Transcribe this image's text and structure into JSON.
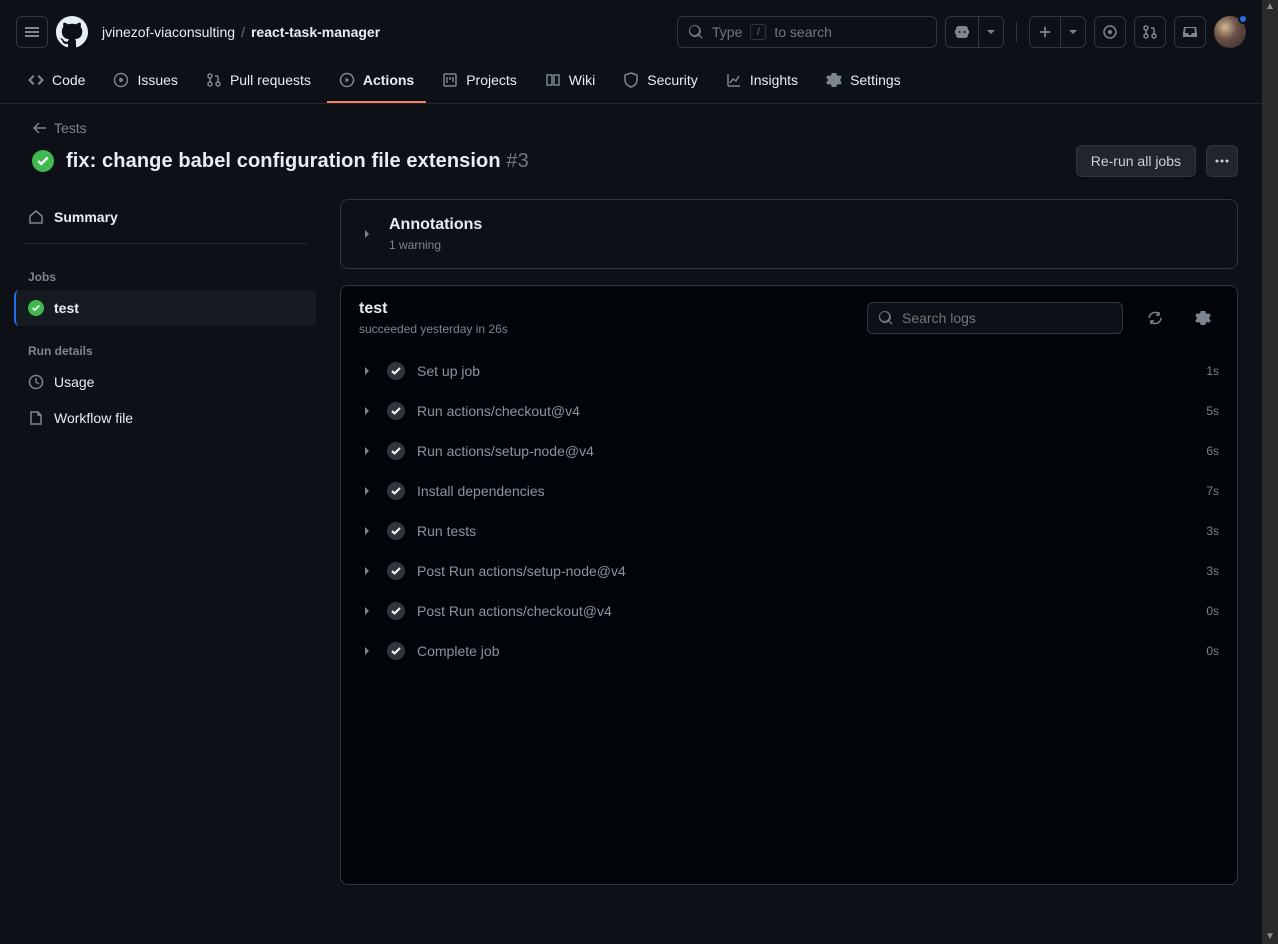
{
  "header": {
    "owner": "jvinezof-viaconsulting",
    "repo": "react-task-manager",
    "search_prefix": "Type",
    "search_kbd": "/",
    "search_suffix": "to search"
  },
  "repo_nav": [
    {
      "label": "Code"
    },
    {
      "label": "Issues"
    },
    {
      "label": "Pull requests"
    },
    {
      "label": "Actions"
    },
    {
      "label": "Projects"
    },
    {
      "label": "Wiki"
    },
    {
      "label": "Security"
    },
    {
      "label": "Insights"
    },
    {
      "label": "Settings"
    }
  ],
  "back_label": "Tests",
  "title": "fix: change babel configuration file extension",
  "run_number": "#3",
  "rerun_label": "Re-run all jobs",
  "sidebar": {
    "summary": "Summary",
    "jobs_header": "Jobs",
    "job": "test",
    "details_header": "Run details",
    "usage": "Usage",
    "workflow_file": "Workflow file"
  },
  "annotations": {
    "title": "Annotations",
    "subtitle": "1 warning"
  },
  "job": {
    "name": "test",
    "status": "succeeded yesterday in 26s",
    "search_placeholder": "Search logs"
  },
  "steps": [
    {
      "name": "Set up job",
      "time": "1s"
    },
    {
      "name": "Run actions/checkout@v4",
      "time": "5s"
    },
    {
      "name": "Run actions/setup-node@v4",
      "time": "6s"
    },
    {
      "name": "Install dependencies",
      "time": "7s"
    },
    {
      "name": "Run tests",
      "time": "3s"
    },
    {
      "name": "Post Run actions/setup-node@v4",
      "time": "3s"
    },
    {
      "name": "Post Run actions/checkout@v4",
      "time": "0s"
    },
    {
      "name": "Complete job",
      "time": "0s"
    }
  ]
}
